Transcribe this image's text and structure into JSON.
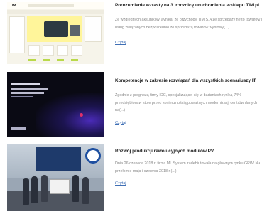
{
  "articles": [
    {
      "title": "Porozumienie wzrasty na 3. rocznicę uruchomienia e-sklepu TIM.pl",
      "description": "Ze względnych aksuników wynika, że przychody TIM S.A ze sprzedaży netto towarów i usług związanych bezpośrednio ze sprzedażą towarów wyniosły(...)",
      "more_label": "Czytaj",
      "thumbnail_logo": "TIM"
    },
    {
      "title": "Kompetencje w zakresie rozwiązań dla wszystkich scenariuszy IT",
      "description": "Zgodnie z prognozą firmy IDC, specjalizującej się w badaniach rynku, 74% przedsiębiorstw stoje przed koniecznością poważnych modernizacji centrów danych na(...)",
      "more_label": "Czytaj"
    },
    {
      "title": "Rozwój produkcji rewolucyjnych modułów PV",
      "description": "Dnia 26 czerwca 2018 r. firma ML System zadebiutowała na głównym rynku GPW. Na przełomie maja i czerwca 2018 r.(...)",
      "more_label": "Czytaj"
    }
  ]
}
